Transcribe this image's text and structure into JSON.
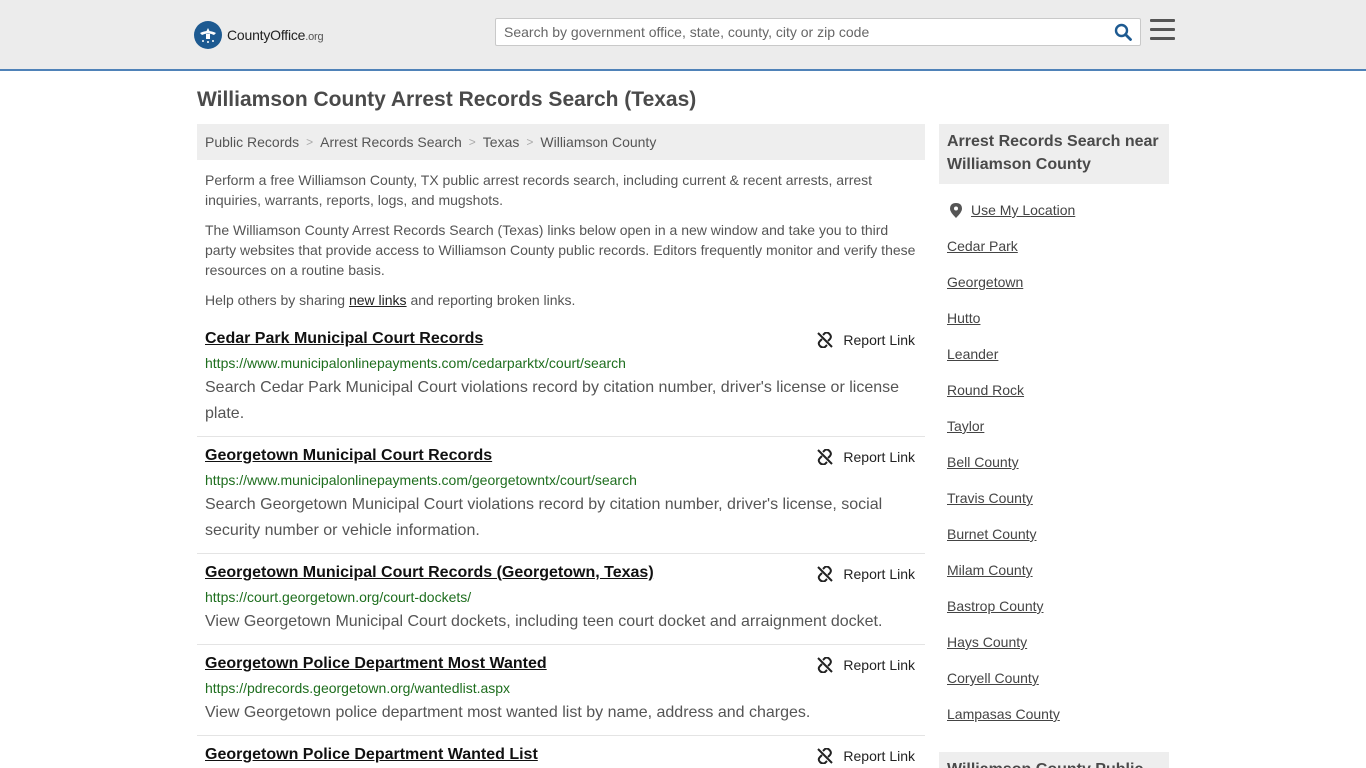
{
  "header": {
    "logo_main": "CountyOffice",
    "logo_tld": ".org",
    "search_placeholder": "Search by government office, state, county, city or zip code"
  },
  "page_title": "Williamson County Arrest Records Search (Texas)",
  "breadcrumb": [
    "Public Records",
    "Arrest Records Search",
    "Texas",
    "Williamson County"
  ],
  "intro": {
    "p1": "Perform a free Williamson County, TX public arrest records search, including current & recent arrests, arrest inquiries, warrants, reports, logs, and mugshots.",
    "p2": "The Williamson County Arrest Records Search (Texas) links below open in a new window and take you to third party websites that provide access to Williamson County public records. Editors frequently monitor and verify these resources on a routine basis.",
    "p3_before": "Help others by sharing ",
    "p3_link": "new links",
    "p3_after": " and reporting broken links."
  },
  "report_label": "Report Link",
  "results": [
    {
      "title": "Cedar Park Municipal Court Records",
      "url": "https://www.municipalonlinepayments.com/cedarparktx/court/search",
      "desc": "Search Cedar Park Municipal Court violations record by citation number, driver's license or license plate."
    },
    {
      "title": "Georgetown Municipal Court Records",
      "url": "https://www.municipalonlinepayments.com/georgetowntx/court/search",
      "desc": "Search Georgetown Municipal Court violations record by citation number, driver's license, social security number or vehicle information."
    },
    {
      "title": "Georgetown Municipal Court Records (Georgetown, Texas)",
      "url": "https://court.georgetown.org/court-dockets/",
      "desc": "View Georgetown Municipal Court dockets, including teen court docket and arraignment docket."
    },
    {
      "title": "Georgetown Police Department Most Wanted",
      "url": "https://pdrecords.georgetown.org/wantedlist.aspx",
      "desc": "View Georgetown police department most wanted list by name, address and charges."
    },
    {
      "title": "Georgetown Police Department Wanted List",
      "url": "",
      "desc": ""
    }
  ],
  "sidebar": {
    "heading": "Arrest Records Search near Williamson County",
    "use_location": "Use My Location",
    "items": [
      "Cedar Park",
      "Georgetown",
      "Hutto",
      "Leander",
      "Round Rock",
      "Taylor",
      "Bell County",
      "Travis County",
      "Burnet County",
      "Milam County",
      "Bastrop County",
      "Hays County",
      "Coryell County",
      "Lampasas County"
    ],
    "heading2": "Williamson County Public"
  }
}
